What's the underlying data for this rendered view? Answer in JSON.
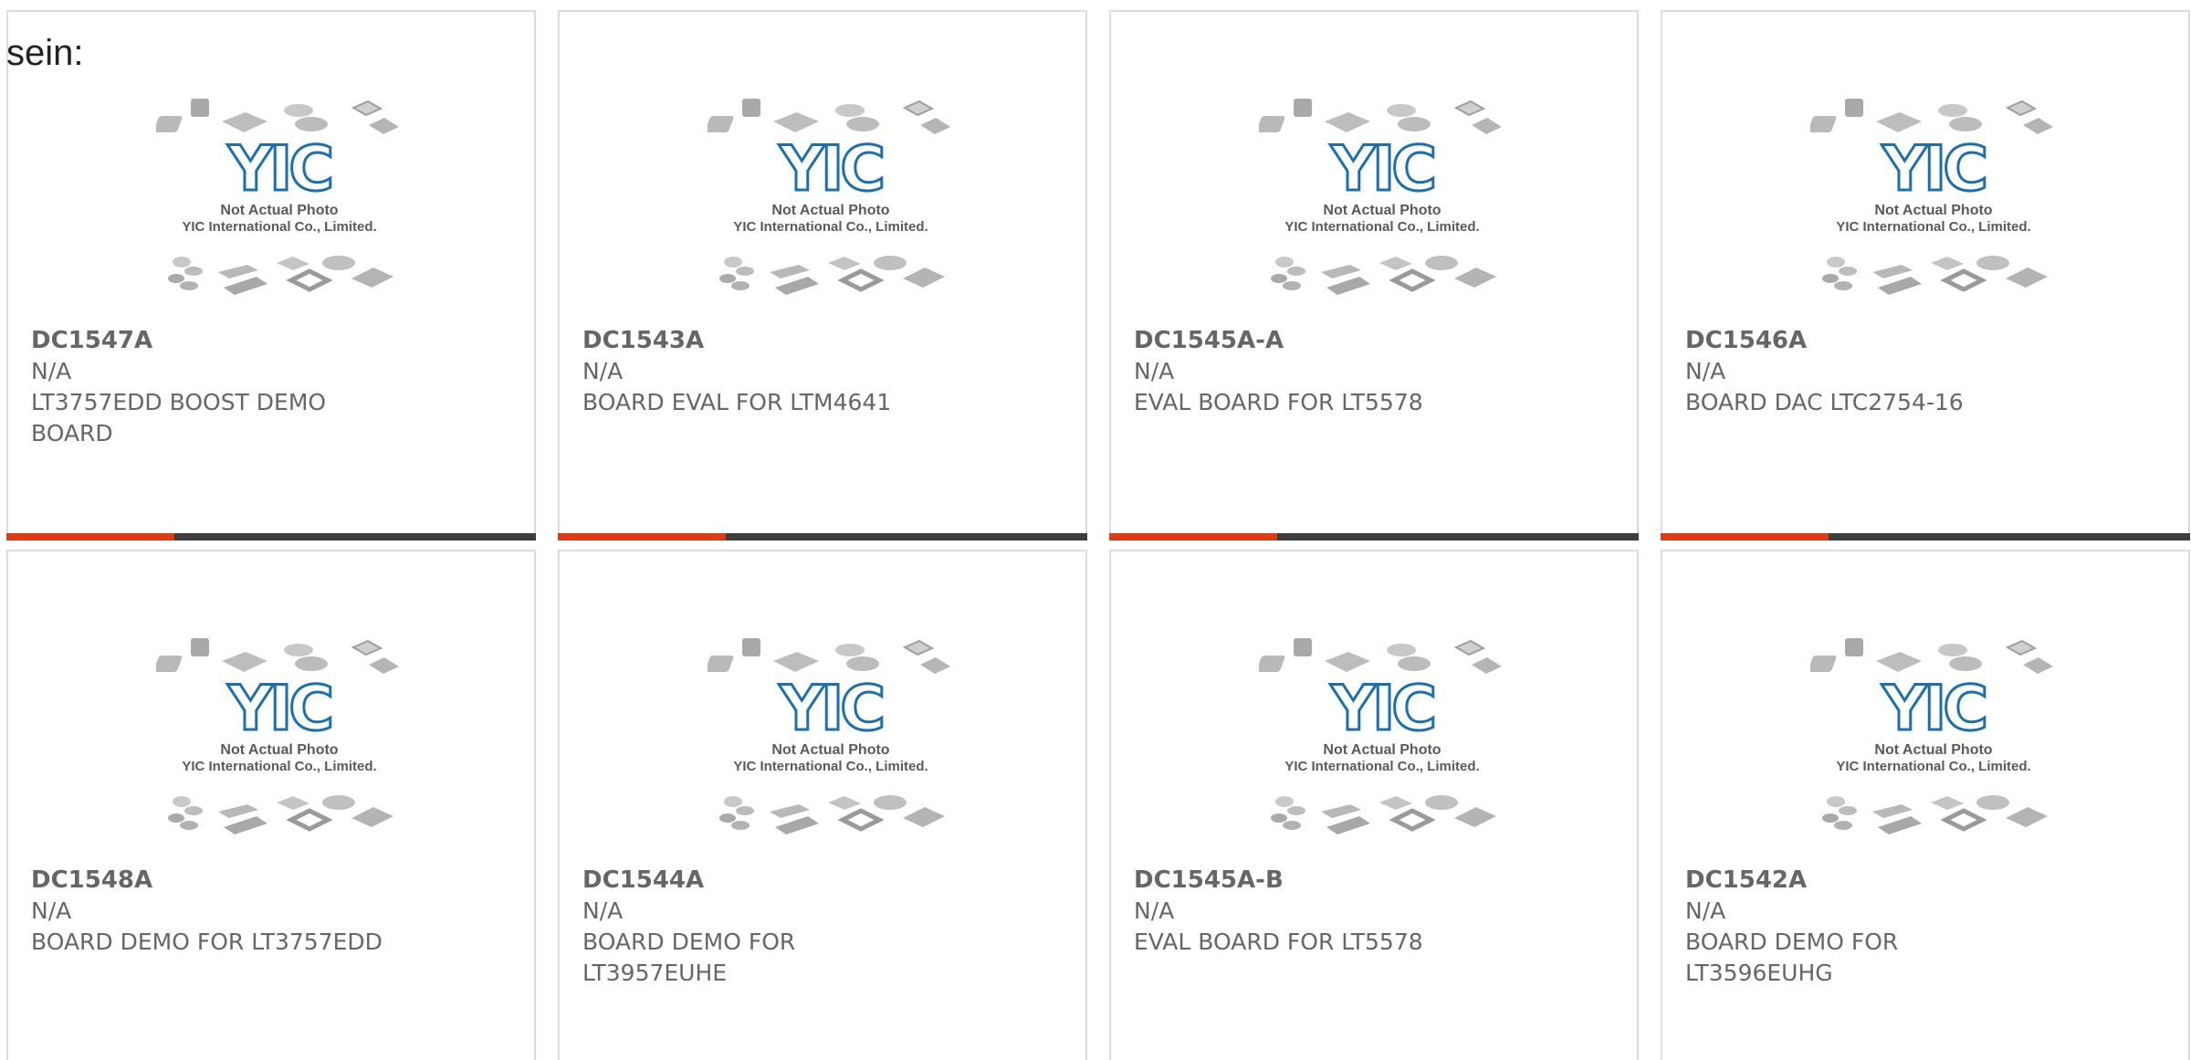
{
  "section_label": "sein:",
  "placeholder": {
    "line1": "Not Actual Photo",
    "line2": "YIC International Co., Limited.",
    "logo_text": "YIC"
  },
  "colors": {
    "accent": "#e03a12",
    "bar": "#3d3d3d",
    "text": "#666666",
    "logo": "#1a6fb0"
  },
  "products": [
    {
      "part": "DC1547A",
      "mfr": "N/A",
      "desc": "LT3757EDD BOOST DEMO BOARD"
    },
    {
      "part": "DC1543A",
      "mfr": "N/A",
      "desc": "BOARD EVAL FOR LTM4641"
    },
    {
      "part": "DC1545A-A",
      "mfr": "N/A",
      "desc": "EVAL BOARD FOR LT5578"
    },
    {
      "part": "DC1546A",
      "mfr": "N/A",
      "desc": "BOARD DAC LTC2754-16"
    },
    {
      "part": "DC1548A",
      "mfr": "N/A",
      "desc": "BOARD DEMO FOR LT3757EDD"
    },
    {
      "part": "DC1544A",
      "mfr": "N/A",
      "desc": "BOARD DEMO FOR LT3957EUHE"
    },
    {
      "part": "DC1545A-B",
      "mfr": "N/A",
      "desc": "EVAL BOARD FOR LT5578"
    },
    {
      "part": "DC1542A",
      "mfr": "N/A",
      "desc": "BOARD DEMO FOR LT3596EUHG"
    }
  ]
}
